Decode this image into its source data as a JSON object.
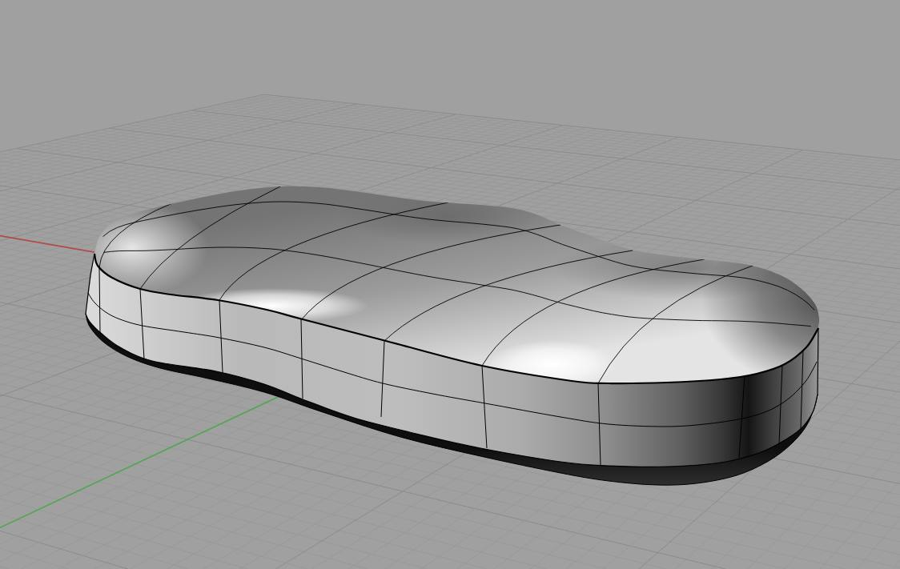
{
  "viewport": {
    "axes": [
      {
        "kind": "x",
        "color": "#b24b4b"
      },
      {
        "kind": "y",
        "color": "#4fa84f"
      }
    ],
    "objects": [
      {
        "kind": "solid",
        "isocurves": true
      }
    ]
  }
}
